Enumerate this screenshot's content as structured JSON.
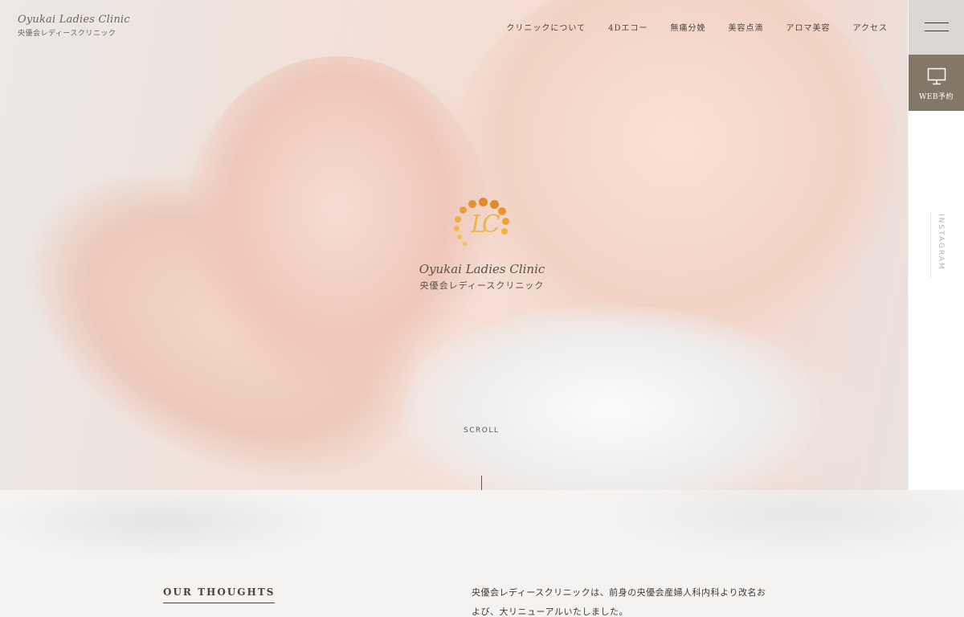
{
  "header": {
    "logo_en": "Oyukai Ladies Clinic",
    "logo_jp": "央優会レディースクリニック"
  },
  "nav": {
    "items": [
      {
        "label": "クリニックについて"
      },
      {
        "label": "4Dエコー"
      },
      {
        "label": "無痛分娩"
      },
      {
        "label": "美容点滴"
      },
      {
        "label": "アロマ美容"
      },
      {
        "label": "アクセス"
      }
    ]
  },
  "hero": {
    "logo_en": "Oyukai Ladies Clinic",
    "logo_jp": "央優会レディースクリニック",
    "scroll_label": "SCROLL"
  },
  "side": {
    "menu_icon": "hamburger-icon",
    "web_icon": "monitor-icon",
    "web_label": "WEB予約",
    "instagram_label": "INSTAGRAM"
  },
  "section": {
    "heading": "OUR THOUGHTS",
    "text": "央優会レディースクリニックは、前身の央優会産婦人科内科より改名および、大リニューアルいたしました。"
  },
  "colors": {
    "web_button_bg": "#857767",
    "menu_bg": "#d9d6d3",
    "logo_gold": "#e7b94a",
    "logo_orange": "#e08a2a"
  }
}
